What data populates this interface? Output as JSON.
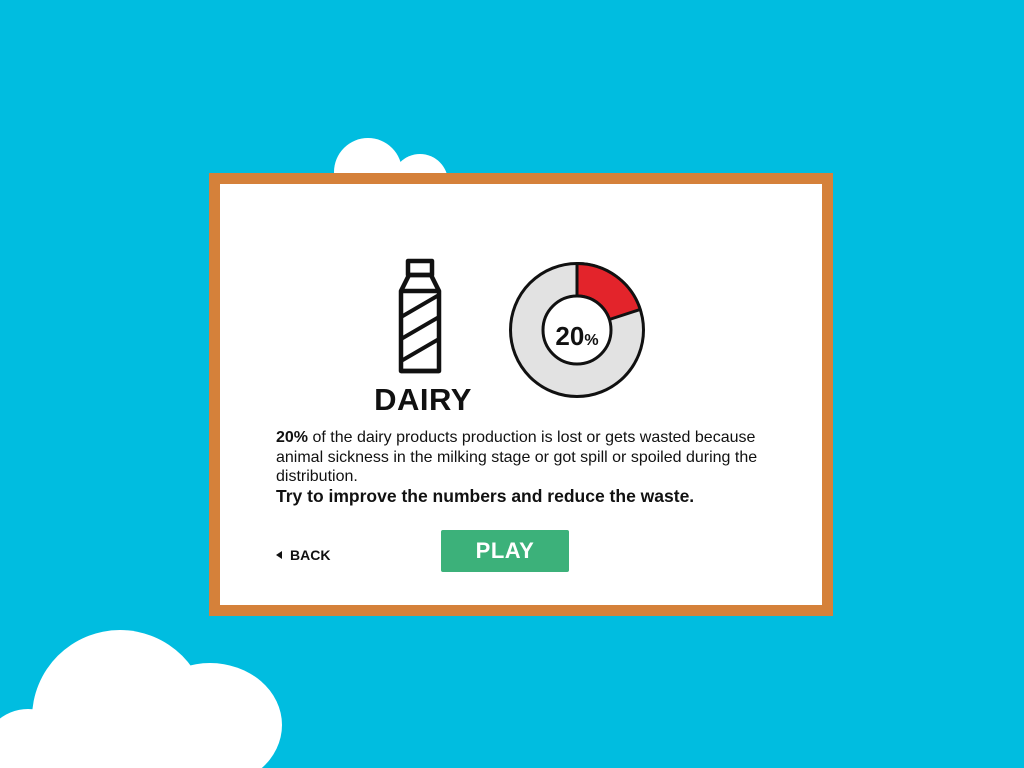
{
  "category": {
    "name": "DAIRY",
    "icon": "milk-bottle-icon"
  },
  "loss_chart": {
    "value_number": "20",
    "value_unit": "%",
    "fraction": 0.2
  },
  "description": {
    "highlight": "20%",
    "text": " of the dairy products production is lost or gets wasted because animal sickness in the milking stage or got spill or spoiled during the distribution.",
    "call_to_action": "Try to improve the numbers and reduce the waste."
  },
  "buttons": {
    "back_label": "BACK",
    "play_label": "PLAY"
  },
  "colors": {
    "sky": "#00bde0",
    "frame": "#d5813a",
    "chart_highlight": "#e3242b",
    "chart_remainder": "#e2e2e2",
    "play_button": "#3cb17a"
  }
}
